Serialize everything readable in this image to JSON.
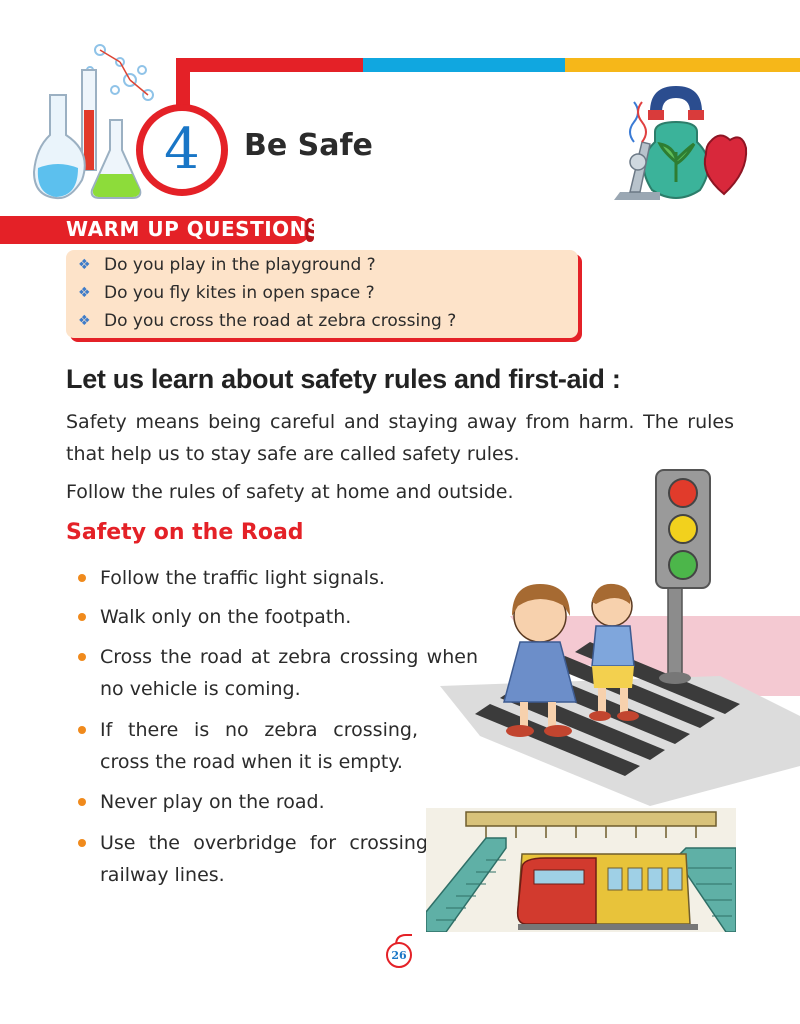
{
  "chapter": {
    "number": "4",
    "title": "Be Safe"
  },
  "warmup": {
    "heading": "WARM UP QUESTIONS",
    "questions": [
      "Do you play in the playground ?",
      "Do you fly kites in open space ?",
      "Do you cross the road at zebra crossing ?"
    ]
  },
  "section": {
    "heading": "Let us learn about safety rules and first-aid :",
    "paragraphs": [
      "Safety means being careful and staying away from harm. The rules that help us to stay safe are called safety rules.",
      "Follow the rules of safety at home and outside."
    ]
  },
  "road_safety": {
    "heading": "Safety on the Road",
    "bullets": [
      "Follow the traffic light signals.",
      "Walk only on the footpath.",
      "Cross the road at zebra crossing when no vehicle is coming.",
      "If there is no zebra crossing, cross the road when it is empty.",
      "Never play on the road.",
      "Use the overbridge for crossing railway lines."
    ]
  },
  "page": {
    "number": "26"
  },
  "colors": {
    "accent_red": "#e42127",
    "accent_blue": "#10a7e0",
    "accent_yellow": "#f6b719",
    "question_box": "#fde3c9"
  }
}
